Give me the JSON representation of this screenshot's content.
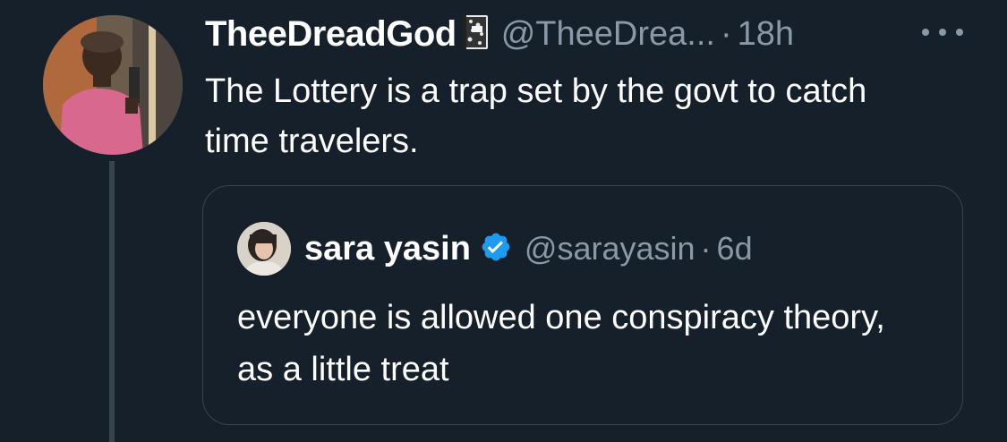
{
  "tweet": {
    "display_name": "TheeDreadGod",
    "handle": "@TheeDrea...",
    "separator": "·",
    "time": "18h",
    "text": "The Lottery is a trap set by the govt to catch time travelers."
  },
  "quoted_tweet": {
    "display_name": "sara yasin",
    "handle": "@sarayasin",
    "separator": "·",
    "time": "6d",
    "text": "everyone is allowed one conspiracy theory, as a little treat"
  },
  "icons": {
    "notebook": "composition-notebook-icon",
    "verified": "verified-badge-icon",
    "more": "more-options-icon"
  },
  "colors": {
    "background": "#15202b",
    "secondary_text": "#8b98a5",
    "border": "#38444d",
    "verified": "#1d9bf0"
  }
}
